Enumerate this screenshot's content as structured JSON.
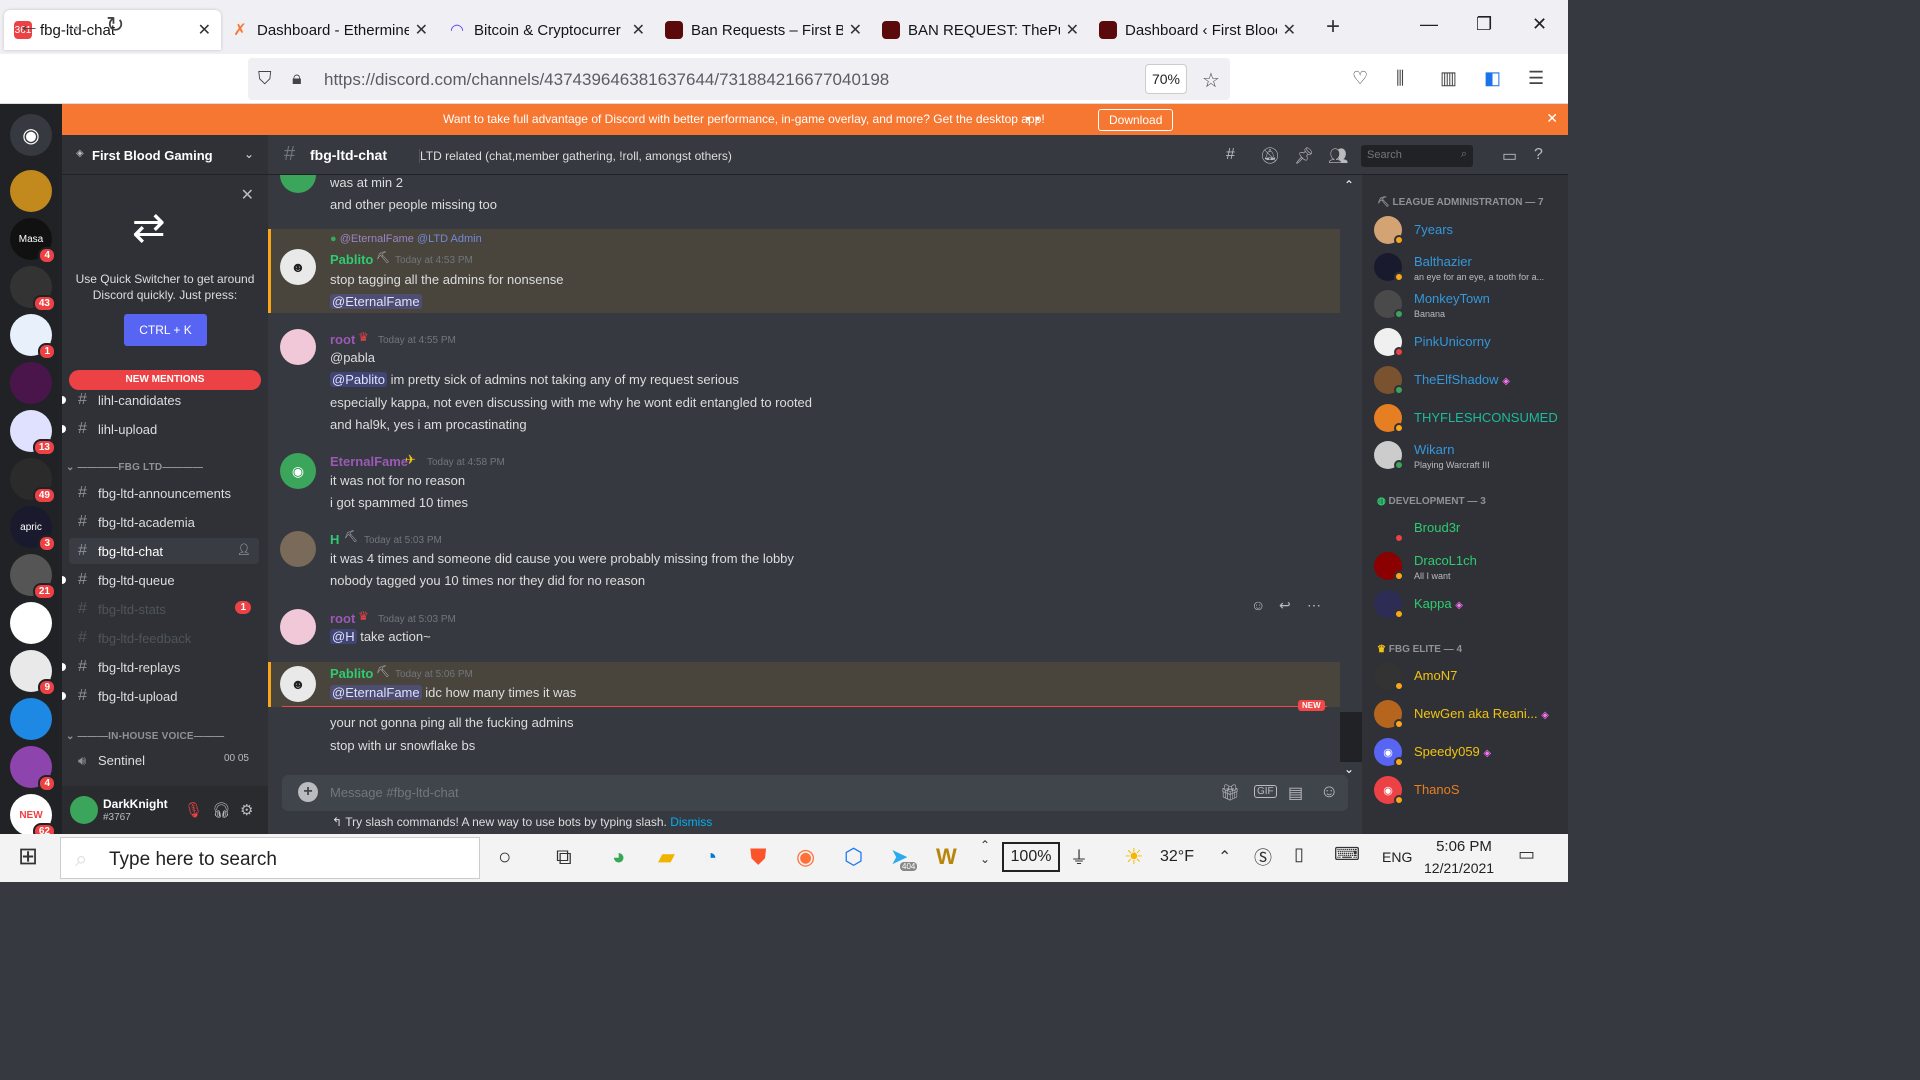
{
  "browser": {
    "tabs": [
      {
        "title": "fbg-ltd-chat",
        "active": true,
        "badge": "361"
      },
      {
        "title": "Dashboard - Ethermine"
      },
      {
        "title": "Bitcoin & Cryptocurrer"
      },
      {
        "title": "Ban Requests – First Bl"
      },
      {
        "title": "BAN REQUEST: ThePur"
      },
      {
        "title": "Dashboard ‹ First Blooc"
      }
    ],
    "url_host": "https://discord.com",
    "url_path": "/channels/437439646381637644/731884216677040198",
    "zoom": "70%"
  },
  "banner": {
    "text": "Want to take full advantage of Discord with better performance, in-game overlay, and more? Get the desktop app!",
    "download": "Download"
  },
  "servers": [
    {
      "badge": ""
    },
    {
      "badge": ""
    },
    {
      "label": "Masa",
      "badge": "4"
    },
    {
      "badge": "43"
    },
    {
      "badge": "1"
    },
    {
      "badge": ""
    },
    {
      "badge": "13"
    },
    {
      "badge": "49"
    },
    {
      "label": "apric",
      "badge": "3"
    },
    {
      "badge": "21"
    },
    {
      "badge": ""
    },
    {
      "badge": "9"
    },
    {
      "badge": ""
    },
    {
      "badge": "4"
    },
    {
      "label": "NEW",
      "badge": "62"
    }
  ],
  "guild": {
    "name": "First Blood Gaming",
    "quick_switcher": {
      "text": "Use Quick Switcher to get around Discord quickly. Just press:",
      "shortcut": "CTRL + K"
    },
    "new_mentions": "NEW MENTIONS",
    "channels_top": [
      {
        "name": "lihl-candidates"
      },
      {
        "name": "lihl-upload"
      }
    ],
    "category_ltd": "FBG LTD",
    "channels_ltd": [
      {
        "name": "fbg-ltd-announcements",
        "muted": false
      },
      {
        "name": "fbg-ltd-academia",
        "muted": false
      },
      {
        "name": "fbg-ltd-chat",
        "active": true
      },
      {
        "name": "fbg-ltd-queue"
      },
      {
        "name": "fbg-ltd-stats",
        "muted": true,
        "badge": "1"
      },
      {
        "name": "fbg-ltd-feedback",
        "muted": true
      },
      {
        "name": "fbg-ltd-replays"
      },
      {
        "name": "fbg-ltd-upload"
      }
    ],
    "category_voice": "IN-HOUSE VOICE",
    "voice": [
      {
        "name": "Sentinel",
        "count_a": "00",
        "count_b": "05"
      }
    ]
  },
  "user": {
    "name": "DarkKnight",
    "tag": "#3767"
  },
  "channel": {
    "name": "fbg-ltd-chat",
    "topic": "LTD related (chat,member gathering, !roll, amongst others)",
    "search_placeholder": "Search"
  },
  "messages": {
    "first_lines": [
      "was at min 2",
      "and other people missing too"
    ],
    "m1": {
      "reply_to": "@EternalFame",
      "reply_text": "@LTD Admin",
      "author": "Pablito",
      "time": "Today at 4:53 PM",
      "lines": [
        "stop tagging all the admins for nonsense"
      ],
      "mention": "@EternalFame"
    },
    "m2": {
      "author": "root",
      "time": "Today at 4:55 PM",
      "line1": "@pabla",
      "mention": "@Pablito",
      "line2_rest": " im pretty sick of admins not taking any of my request serious",
      "line3": "especially kappa, not even discussing with me why he wont edit entangled to rooted",
      "line4": "and hal9k, yes i am procastinating"
    },
    "m3": {
      "author": "EternalFame",
      "time": "Today at 4:58 PM",
      "line1": "it was not for no reason",
      "line2": "i got spammed 10 times"
    },
    "m4": {
      "author": "H",
      "time": "Today at 5:03 PM",
      "line1": "it was 4 times and someone did cause you were probably missing from the lobby",
      "line2": "nobody tagged you 10 times nor they did for no reason"
    },
    "m5": {
      "author": "root",
      "time": "Today at 5:03 PM",
      "mention": "@H",
      "rest": " take action~"
    },
    "m6": {
      "author": "Pablito",
      "time": "Today at 5:06 PM",
      "mention": "@EternalFame",
      "rest": " idc how many times it was",
      "line2": "your not gonna ping all the fucking admins",
      "line3": "stop with ur snowflake bs"
    },
    "new_label": "NEW"
  },
  "composer": {
    "placeholder": "Message #fbg-ltd-chat",
    "slash_tip": "Try slash commands! A new way to use bots by typing slash.",
    "dismiss": "Dismiss"
  },
  "members": {
    "cat1": "LEAGUE ADMINISTRATION — 7",
    "list1": [
      {
        "name": "7years",
        "color": "#3498db",
        "status": "#faa61a"
      },
      {
        "name": "Balthazier",
        "sub": "an eye for an eye, a tooth for a...",
        "color": "#3498db",
        "status": "#faa61a"
      },
      {
        "name": "MonkeyTown",
        "sub": "Banana",
        "color": "#3498db",
        "status": "#3ba55c"
      },
      {
        "name": "PinkUnicorny",
        "color": "#3498db",
        "status": "#ed4245"
      },
      {
        "name": "TheElfShadow",
        "color": "#3498db",
        "status": "#3ba55c"
      },
      {
        "name": "THYFLESHCONSUMED",
        "color": "#1abc9c",
        "status": "#faa61a"
      },
      {
        "name": "Wikarn",
        "sub": "Playing Warcraft III",
        "color": "#3498db",
        "status": "#3ba55c"
      }
    ],
    "cat2": "DEVELOPMENT — 3",
    "list2": [
      {
        "name": "Broud3r",
        "color": "#2ecc71",
        "status": "#ed4245"
      },
      {
        "name": "DracoL1ch",
        "sub": "All I want",
        "color": "#2ecc71",
        "status": "#faa61a"
      },
      {
        "name": "Kappa",
        "color": "#2ecc71",
        "status": "#faa61a"
      }
    ],
    "cat3": "FBG ELITE — 4",
    "list3": [
      {
        "name": "AmoN7",
        "color": "#f1c40f",
        "status": "#faa61a"
      },
      {
        "name": "NewGen aka Reani...",
        "color": "#f1c40f",
        "status": "#faa61a"
      },
      {
        "name": "Speedy059",
        "color": "#f1c40f",
        "status": "#faa61a"
      },
      {
        "name": "ThanoS",
        "color": "#e67e22",
        "status": "#faa61a"
      }
    ]
  },
  "taskbar": {
    "search": "Type here to search",
    "battery": "100%",
    "temp": "32°F",
    "lang": "ENG",
    "time": "5:06 PM",
    "date": "12/21/2021",
    "telegram_badge": "404"
  }
}
